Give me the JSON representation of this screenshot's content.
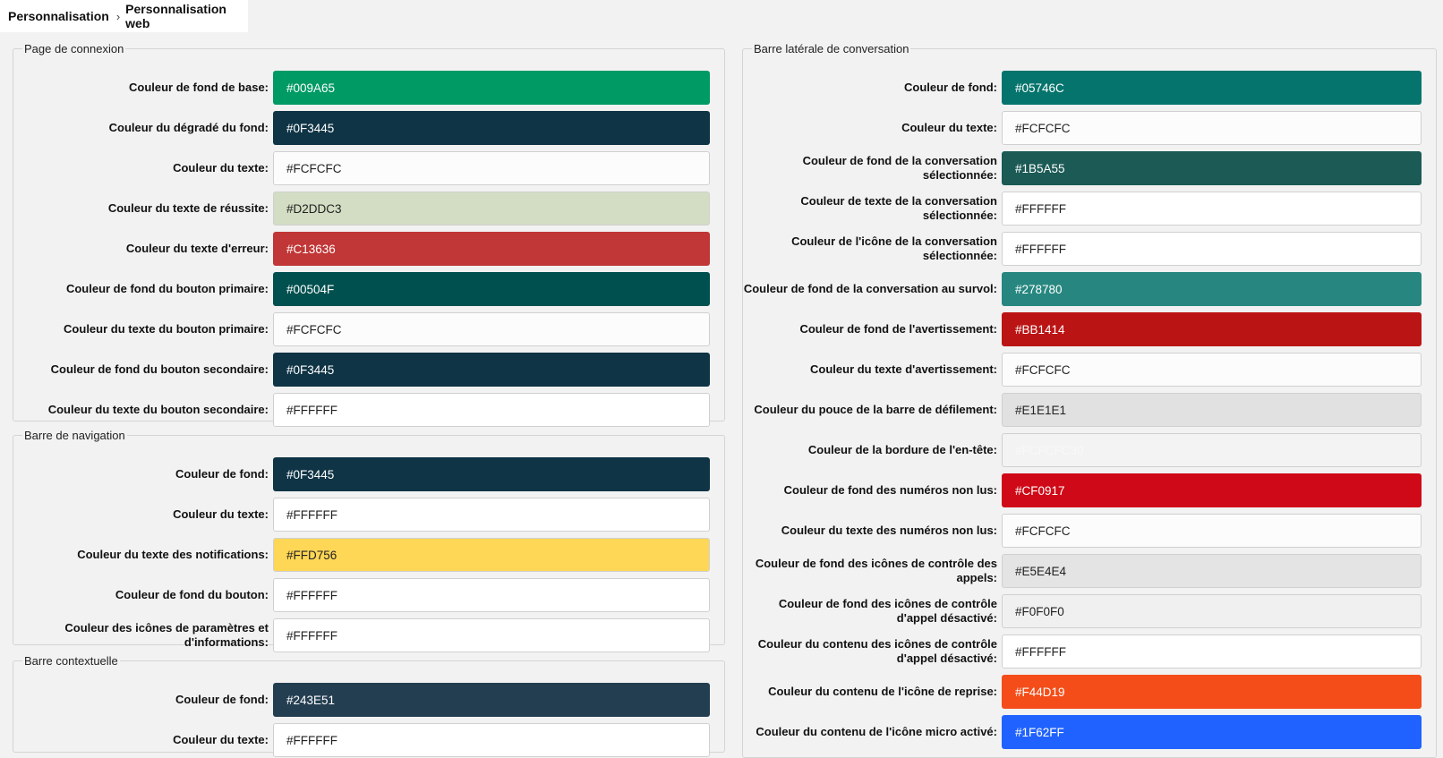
{
  "breadcrumb": {
    "root": "Personnalisation",
    "current": "Personnalisation web",
    "separator": "›"
  },
  "sections": {
    "connexion": {
      "title": "Page de connexion",
      "rows": [
        {
          "label": "Couleur de fond de base:",
          "value": "#009A65",
          "color": "#009A65"
        },
        {
          "label": "Couleur du dégradé du fond:",
          "value": "#0F3445",
          "color": "#0F3445"
        },
        {
          "label": "Couleur du texte:",
          "value": "#FCFCFC",
          "color": "#FCFCFC"
        },
        {
          "label": "Couleur du texte de réussite:",
          "value": "#D2DDC3",
          "color": "#D2DDC3"
        },
        {
          "label": "Couleur du texte d'erreur:",
          "value": "#C13636",
          "color": "#C13636"
        },
        {
          "label": "Couleur de fond du bouton primaire:",
          "value": "#00504F",
          "color": "#00504F"
        },
        {
          "label": "Couleur du texte du bouton primaire:",
          "value": "#FCFCFC",
          "color": "#FCFCFC"
        },
        {
          "label": "Couleur de fond du bouton secondaire:",
          "value": "#0F3445",
          "color": "#0F3445"
        },
        {
          "label": "Couleur du texte du bouton secondaire:",
          "value": "#FFFFFF",
          "color": "#FFFFFF"
        }
      ]
    },
    "navigation": {
      "title": "Barre de navigation",
      "rows": [
        {
          "label": "Couleur de fond:",
          "value": "#0F3445",
          "color": "#0F3445"
        },
        {
          "label": "Couleur du texte:",
          "value": "#FFFFFF",
          "color": "#FFFFFF"
        },
        {
          "label": "Couleur du texte des notifications:",
          "value": "#FFD756",
          "color": "#FFD756"
        },
        {
          "label": "Couleur de fond du bouton:",
          "value": "#FFFFFF",
          "color": "#FFFFFF"
        },
        {
          "label": "Couleur des icônes de paramètres et d'informations:",
          "value": "#FFFFFF",
          "color": "#FFFFFF"
        }
      ]
    },
    "contextuelle": {
      "title": "Barre contextuelle",
      "rows": [
        {
          "label": "Couleur de fond:",
          "value": "#243E51",
          "color": "#243E51"
        },
        {
          "label": "Couleur du texte:",
          "value": "#FFFFFF",
          "color": "#FFFFFF"
        }
      ]
    },
    "laterale": {
      "title": "Barre latérale de conversation",
      "rows": [
        {
          "label": "Couleur de fond:",
          "value": "#05746C",
          "color": "#05746C"
        },
        {
          "label": "Couleur du texte:",
          "value": "#FCFCFC",
          "color": "#FCFCFC"
        },
        {
          "label": "Couleur de fond de la conversation sélectionnée:",
          "value": "#1B5A55",
          "color": "#1B5A55"
        },
        {
          "label": "Couleur de texte de la conversation sélectionnée:",
          "value": "#FFFFFF",
          "color": "#FFFFFF"
        },
        {
          "label": "Couleur de l'icône de la conversation sélectionnée:",
          "value": "#FFFFFF",
          "color": "#FFFFFF"
        },
        {
          "label": "Couleur de fond de la conversation au survol:",
          "value": "#278780",
          "color": "#278780"
        },
        {
          "label": "Couleur de fond de l'avertissement:",
          "value": "#BB1414",
          "color": "#BB1414"
        },
        {
          "label": "Couleur du texte d'avertissement:",
          "value": "#FCFCFC",
          "color": "#FCFCFC"
        },
        {
          "label": "Couleur du pouce de la barre de défilement:",
          "value": "#E1E1E1",
          "color": "#E1E1E1"
        },
        {
          "label": "Couleur de la bordure de l'en-tête:",
          "value": "#FCFCFC30",
          "color": "#F3F3F3"
        },
        {
          "label": "Couleur de fond des numéros non lus:",
          "value": "#CF0917",
          "color": "#CF0917"
        },
        {
          "label": "Couleur du texte des numéros non lus:",
          "value": "#FCFCFC",
          "color": "#FCFCFC"
        },
        {
          "label": "Couleur de fond des icônes de contrôle des appels:",
          "value": "#E5E4E4",
          "color": "#E5E4E4"
        },
        {
          "label": "Couleur de fond des icônes de contrôle d'appel désactivé:",
          "value": "#F0F0F0",
          "color": "#F0F0F0"
        },
        {
          "label": "Couleur du contenu des icônes de contrôle d'appel désactivé:",
          "value": "#FFFFFF",
          "color": "#FFFFFF"
        },
        {
          "label": "Couleur du contenu de l'icône de reprise:",
          "value": "#F44D19",
          "color": "#F44D19"
        },
        {
          "label": "Couleur du contenu de l'icône micro activé:",
          "value": "#1F62FF",
          "color": "#1F62FF"
        }
      ]
    }
  }
}
